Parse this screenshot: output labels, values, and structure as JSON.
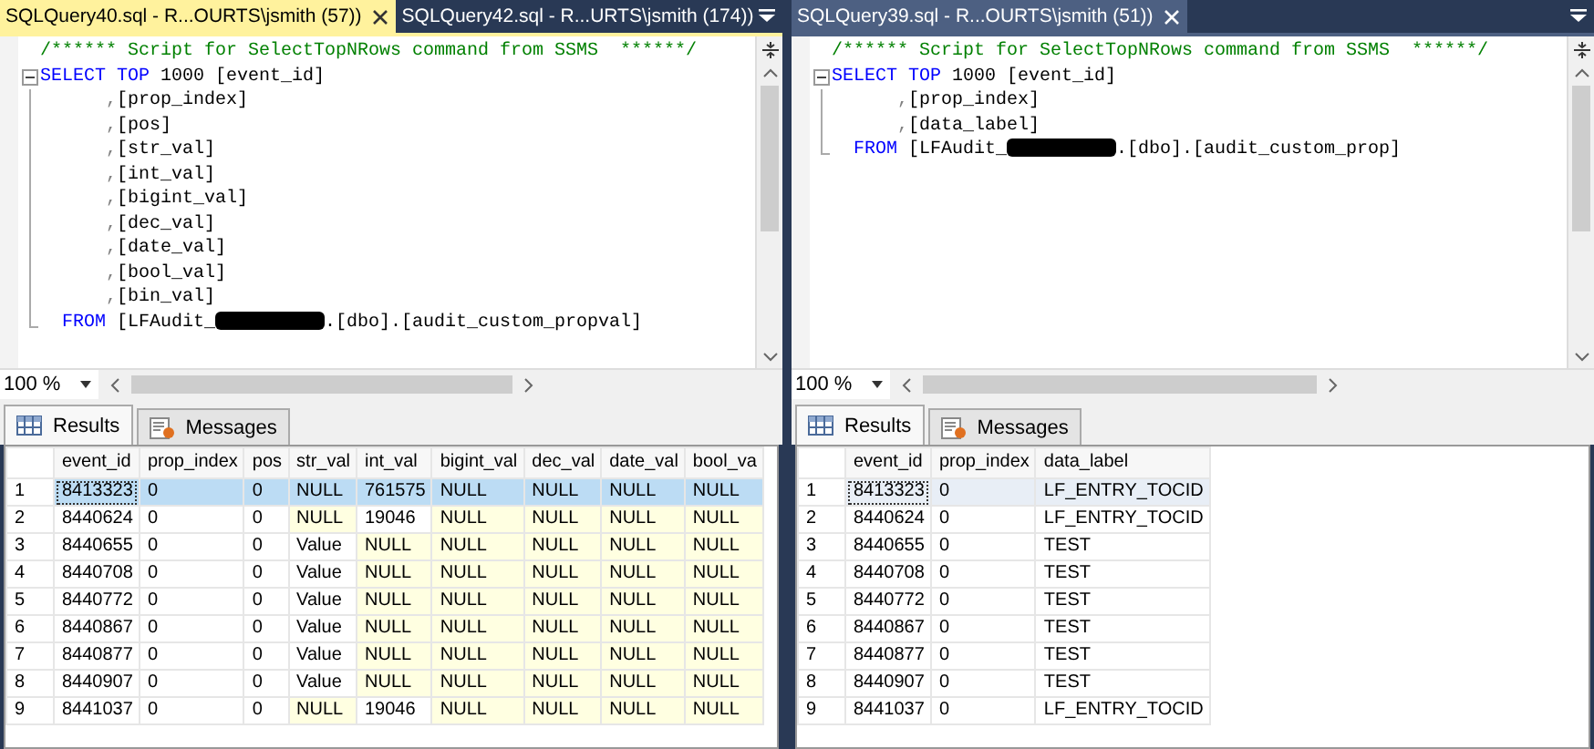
{
  "panes": [
    {
      "focused": true,
      "tabs": [
        {
          "label": "SQLQuery40.sql - R...OURTS\\jsmith (57))",
          "selected": true
        },
        {
          "label": "SQLQuery42.sql - R...URTS\\jsmith (174))",
          "selected": false
        }
      ],
      "editor": {
        "lines": [
          {
            "tokens": [
              {
                "kind": "comment",
                "text": "/****** Script for SelectTopNRows command from SSMS  ******/"
              }
            ]
          },
          {
            "tokens": [
              {
                "kind": "keyword",
                "text": "SELECT TOP"
              },
              {
                "kind": "plain",
                "text": " 1000 [event_id]"
              }
            ]
          },
          {
            "tokens": [
              {
                "kind": "punct",
                "text": "      ,"
              },
              {
                "kind": "plain",
                "text": "[prop_index]"
              }
            ]
          },
          {
            "tokens": [
              {
                "kind": "punct",
                "text": "      ,"
              },
              {
                "kind": "plain",
                "text": "[pos]"
              }
            ]
          },
          {
            "tokens": [
              {
                "kind": "punct",
                "text": "      ,"
              },
              {
                "kind": "plain",
                "text": "[str_val]"
              }
            ]
          },
          {
            "tokens": [
              {
                "kind": "punct",
                "text": "      ,"
              },
              {
                "kind": "plain",
                "text": "[int_val]"
              }
            ]
          },
          {
            "tokens": [
              {
                "kind": "punct",
                "text": "      ,"
              },
              {
                "kind": "plain",
                "text": "[bigint_val]"
              }
            ]
          },
          {
            "tokens": [
              {
                "kind": "punct",
                "text": "      ,"
              },
              {
                "kind": "plain",
                "text": "[dec_val]"
              }
            ]
          },
          {
            "tokens": [
              {
                "kind": "punct",
                "text": "      ,"
              },
              {
                "kind": "plain",
                "text": "[date_val]"
              }
            ]
          },
          {
            "tokens": [
              {
                "kind": "punct",
                "text": "      ,"
              },
              {
                "kind": "plain",
                "text": "[bool_val]"
              }
            ]
          },
          {
            "tokens": [
              {
                "kind": "punct",
                "text": "      ,"
              },
              {
                "kind": "plain",
                "text": "[bin_val]"
              }
            ]
          },
          {
            "tokens": [
              {
                "kind": "keyword",
                "text": "  FROM"
              },
              {
                "kind": "plain",
                "text": " [LFAudit_"
              },
              {
                "kind": "redacted"
              },
              {
                "kind": "plain",
                "text": ".[dbo].[audit_custom_propval]"
              }
            ]
          }
        ]
      },
      "zoom": "100 %",
      "result_tabs": [
        {
          "label": "Results",
          "selected": true
        },
        {
          "label": "Messages",
          "selected": false
        }
      ],
      "grid": {
        "columns": [
          "event_id",
          "prop_index",
          "pos",
          "str_val",
          "int_val",
          "bigint_val",
          "dec_val",
          "date_val",
          "bool_va"
        ],
        "rows": [
          {
            "number": "1",
            "selected": true,
            "cells": [
              {
                "text": "8413323"
              },
              {
                "text": "0"
              },
              {
                "text": "0"
              },
              {
                "text": "NULL"
              },
              {
                "text": "761575"
              },
              {
                "text": "NULL"
              },
              {
                "text": "NULL"
              },
              {
                "text": "NULL"
              },
              {
                "text": "NULL"
              }
            ]
          },
          {
            "number": "2",
            "selected": false,
            "cells": [
              {
                "text": "8440624",
                "null": false
              },
              {
                "text": "0",
                "null": false
              },
              {
                "text": "0",
                "null": false
              },
              {
                "text": "NULL",
                "null": true
              },
              {
                "text": "19046",
                "null": false
              },
              {
                "text": "NULL",
                "null": true
              },
              {
                "text": "NULL",
                "null": true
              },
              {
                "text": "NULL",
                "null": true
              },
              {
                "text": "NULL",
                "null": true
              }
            ]
          },
          {
            "number": "3",
            "selected": false,
            "cells": [
              {
                "text": "8440655",
                "null": false
              },
              {
                "text": "0",
                "null": false
              },
              {
                "text": "0",
                "null": false
              },
              {
                "text": "Value",
                "null": false
              },
              {
                "text": "NULL",
                "null": true
              },
              {
                "text": "NULL",
                "null": true
              },
              {
                "text": "NULL",
                "null": true
              },
              {
                "text": "NULL",
                "null": true
              },
              {
                "text": "NULL",
                "null": true
              }
            ]
          },
          {
            "number": "4",
            "selected": false,
            "cells": [
              {
                "text": "8440708",
                "null": false
              },
              {
                "text": "0",
                "null": false
              },
              {
                "text": "0",
                "null": false
              },
              {
                "text": "Value",
                "null": false
              },
              {
                "text": "NULL",
                "null": true
              },
              {
                "text": "NULL",
                "null": true
              },
              {
                "text": "NULL",
                "null": true
              },
              {
                "text": "NULL",
                "null": true
              },
              {
                "text": "NULL",
                "null": true
              }
            ]
          },
          {
            "number": "5",
            "selected": false,
            "cells": [
              {
                "text": "8440772",
                "null": false
              },
              {
                "text": "0",
                "null": false
              },
              {
                "text": "0",
                "null": false
              },
              {
                "text": "Value",
                "null": false
              },
              {
                "text": "NULL",
                "null": true
              },
              {
                "text": "NULL",
                "null": true
              },
              {
                "text": "NULL",
                "null": true
              },
              {
                "text": "NULL",
                "null": true
              },
              {
                "text": "NULL",
                "null": true
              }
            ]
          },
          {
            "number": "6",
            "selected": false,
            "cells": [
              {
                "text": "8440867",
                "null": false
              },
              {
                "text": "0",
                "null": false
              },
              {
                "text": "0",
                "null": false
              },
              {
                "text": "Value",
                "null": false
              },
              {
                "text": "NULL",
                "null": true
              },
              {
                "text": "NULL",
                "null": true
              },
              {
                "text": "NULL",
                "null": true
              },
              {
                "text": "NULL",
                "null": true
              },
              {
                "text": "NULL",
                "null": true
              }
            ]
          },
          {
            "number": "7",
            "selected": false,
            "cells": [
              {
                "text": "8440877",
                "null": false
              },
              {
                "text": "0",
                "null": false
              },
              {
                "text": "0",
                "null": false
              },
              {
                "text": "Value",
                "null": false
              },
              {
                "text": "NULL",
                "null": true
              },
              {
                "text": "NULL",
                "null": true
              },
              {
                "text": "NULL",
                "null": true
              },
              {
                "text": "NULL",
                "null": true
              },
              {
                "text": "NULL",
                "null": true
              }
            ]
          },
          {
            "number": "8",
            "selected": false,
            "cells": [
              {
                "text": "8440907",
                "null": false
              },
              {
                "text": "0",
                "null": false
              },
              {
                "text": "0",
                "null": false
              },
              {
                "text": "Value",
                "null": false
              },
              {
                "text": "NULL",
                "null": true
              },
              {
                "text": "NULL",
                "null": true
              },
              {
                "text": "NULL",
                "null": true
              },
              {
                "text": "NULL",
                "null": true
              },
              {
                "text": "NULL",
                "null": true
              }
            ]
          },
          {
            "number": "9",
            "selected": false,
            "cells": [
              {
                "text": "8441037",
                "null": false
              },
              {
                "text": "0",
                "null": false
              },
              {
                "text": "0",
                "null": false
              },
              {
                "text": "NULL",
                "null": true
              },
              {
                "text": "19046",
                "null": false
              },
              {
                "text": "NULL",
                "null": true
              },
              {
                "text": "NULL",
                "null": true
              },
              {
                "text": "NULL",
                "null": true
              },
              {
                "text": "NULL",
                "null": true
              }
            ]
          }
        ]
      }
    },
    {
      "focused": false,
      "tabs": [
        {
          "label": "SQLQuery39.sql - R...OURTS\\jsmith (51))",
          "selected": true
        }
      ],
      "editor": {
        "lines": [
          {
            "tokens": [
              {
                "kind": "comment",
                "text": "/****** Script for SelectTopNRows command from SSMS  ******/"
              }
            ]
          },
          {
            "tokens": [
              {
                "kind": "keyword",
                "text": "SELECT TOP"
              },
              {
                "kind": "plain",
                "text": " 1000 [event_id]"
              }
            ]
          },
          {
            "tokens": [
              {
                "kind": "punct",
                "text": "      ,"
              },
              {
                "kind": "plain",
                "text": "[prop_index]"
              }
            ]
          },
          {
            "tokens": [
              {
                "kind": "punct",
                "text": "      ,"
              },
              {
                "kind": "plain",
                "text": "[data_label]"
              }
            ]
          },
          {
            "tokens": [
              {
                "kind": "keyword",
                "text": "  FROM"
              },
              {
                "kind": "plain",
                "text": " [LFAudit_"
              },
              {
                "kind": "redacted"
              },
              {
                "kind": "plain",
                "text": ".[dbo].[audit_custom_prop]"
              }
            ]
          }
        ]
      },
      "zoom": "100 %",
      "result_tabs": [
        {
          "label": "Results",
          "selected": true
        },
        {
          "label": "Messages",
          "selected": false
        }
      ],
      "grid": {
        "columns": [
          "event_id",
          "prop_index",
          "data_label"
        ],
        "rows": [
          {
            "number": "1",
            "selected": true,
            "cells": [
              {
                "text": "8413323",
                "null": false
              },
              {
                "text": "0",
                "null": false
              },
              {
                "text": "LF_ENTRY_TOCID",
                "null": false
              }
            ]
          },
          {
            "number": "2",
            "selected": false,
            "cells": [
              {
                "text": "8440624",
                "null": false
              },
              {
                "text": "0",
                "null": false
              },
              {
                "text": "LF_ENTRY_TOCID",
                "null": false
              }
            ]
          },
          {
            "number": "3",
            "selected": false,
            "cells": [
              {
                "text": "8440655",
                "null": false
              },
              {
                "text": "0",
                "null": false
              },
              {
                "text": "TEST",
                "null": false
              }
            ]
          },
          {
            "number": "4",
            "selected": false,
            "cells": [
              {
                "text": "8440708",
                "null": false
              },
              {
                "text": "0",
                "null": false
              },
              {
                "text": "TEST",
                "null": false
              }
            ]
          },
          {
            "number": "5",
            "selected": false,
            "cells": [
              {
                "text": "8440772",
                "null": false
              },
              {
                "text": "0",
                "null": false
              },
              {
                "text": "TEST",
                "null": false
              }
            ]
          },
          {
            "number": "6",
            "selected": false,
            "cells": [
              {
                "text": "8440867",
                "null": false
              },
              {
                "text": "0",
                "null": false
              },
              {
                "text": "TEST",
                "null": false
              }
            ]
          },
          {
            "number": "7",
            "selected": false,
            "cells": [
              {
                "text": "8440877",
                "null": false
              },
              {
                "text": "0",
                "null": false
              },
              {
                "text": "TEST",
                "null": false
              }
            ]
          },
          {
            "number": "8",
            "selected": false,
            "cells": [
              {
                "text": "8440907",
                "null": false
              },
              {
                "text": "0",
                "null": false
              },
              {
                "text": "TEST",
                "null": false
              }
            ]
          },
          {
            "number": "9",
            "selected": false,
            "cells": [
              {
                "text": "8441037",
                "null": false
              },
              {
                "text": "0",
                "null": false
              },
              {
                "text": "LF_ENTRY_TOCID",
                "null": false
              }
            ]
          }
        ]
      }
    }
  ]
}
